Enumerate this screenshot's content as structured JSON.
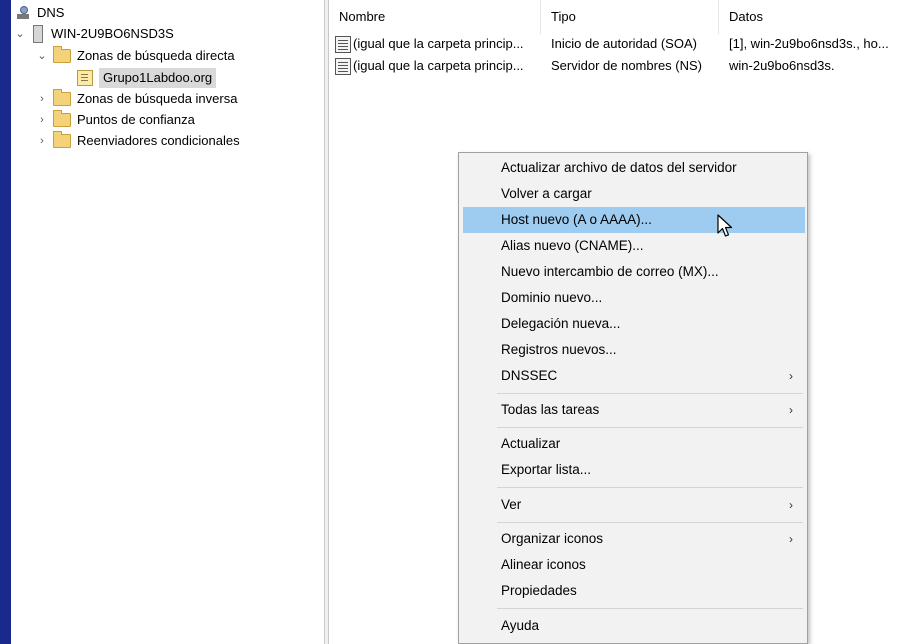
{
  "tree": {
    "root": "DNS",
    "server": "WIN-2U9BO6NSD3S",
    "forward_zones": "Zonas de búsqueda directa",
    "selected_zone": "Grupo1Labdoo.org",
    "reverse_zones": "Zonas de búsqueda inversa",
    "trust_points": "Puntos de confianza",
    "conditional_forwarders": "Reenviadores condicionales"
  },
  "list": {
    "columns": [
      "Nombre",
      "Tipo",
      "Datos"
    ],
    "rows": [
      {
        "name": "(igual que la carpeta princip...",
        "type": "Inicio de autoridad (SOA)",
        "data": "[1], win-2u9bo6nsd3s., ho..."
      },
      {
        "name": "(igual que la carpeta princip...",
        "type": "Servidor de nombres (NS)",
        "data": "win-2u9bo6nsd3s."
      }
    ]
  },
  "menu": {
    "items": [
      "Actualizar archivo de datos del servidor",
      "Volver a cargar",
      "Host nuevo (A o AAAA)...",
      "Alias nuevo (CNAME)...",
      "Nuevo intercambio de correo (MX)...",
      "Dominio nuevo...",
      "Delegación nueva...",
      "Registros nuevos...",
      "DNSSEC",
      "Todas las tareas",
      "Actualizar",
      "Exportar lista...",
      "Ver",
      "Organizar iconos",
      "Alinear iconos",
      "Propiedades",
      "Ayuda"
    ],
    "highlighted": "Host nuevo (A o AAAA)...",
    "submenu_arrow": "›"
  },
  "colors": {
    "desktop": "#1a2a8c",
    "menu_bg": "#f2f2f2",
    "menu_highlight": "#9ecbf0",
    "tree_selection": "#d9d9d9"
  },
  "icons": {
    "dns": "dns-server-icon",
    "server": "server-icon",
    "folder": "folder-icon",
    "zone": "zone-file-icon",
    "record": "record-icon",
    "expanded": "chevron-down-icon",
    "collapsed": "chevron-right-icon",
    "pointer": "mouse-pointer-icon"
  }
}
